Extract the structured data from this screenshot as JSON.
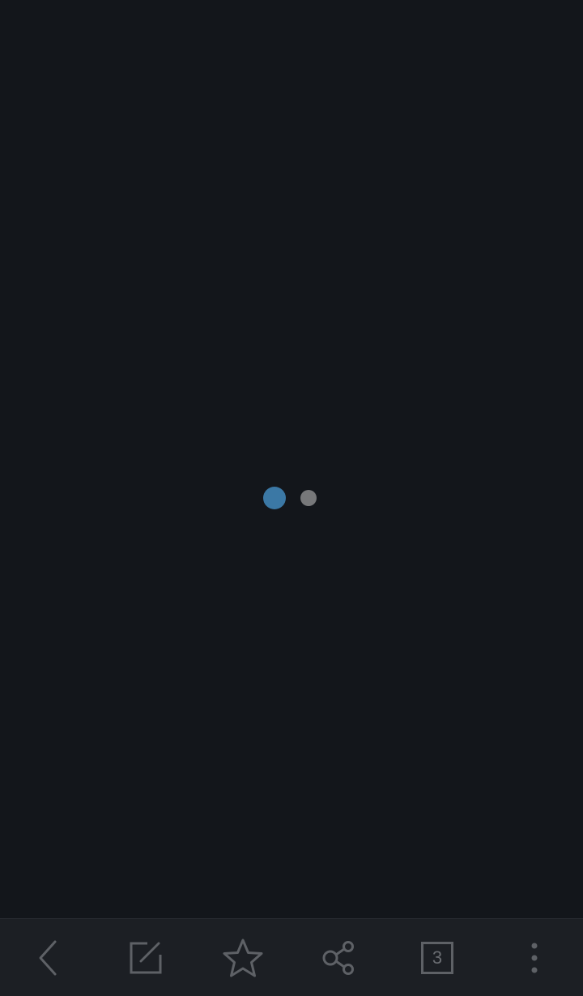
{
  "loader": {
    "active_color": "#3b78a5",
    "idle_color": "#77787a"
  },
  "toolbar": {
    "icon_color": "#5e6166",
    "tabs_count": "3",
    "items": [
      {
        "name": "back-button",
        "icon": "chevron-left-icon"
      },
      {
        "name": "edit-button",
        "icon": "edit-icon"
      },
      {
        "name": "bookmark-button",
        "icon": "star-icon"
      },
      {
        "name": "share-button",
        "icon": "share-icon"
      },
      {
        "name": "tabs-button",
        "icon": "tabs-icon"
      },
      {
        "name": "menu-button",
        "icon": "more-vertical-icon"
      }
    ]
  }
}
